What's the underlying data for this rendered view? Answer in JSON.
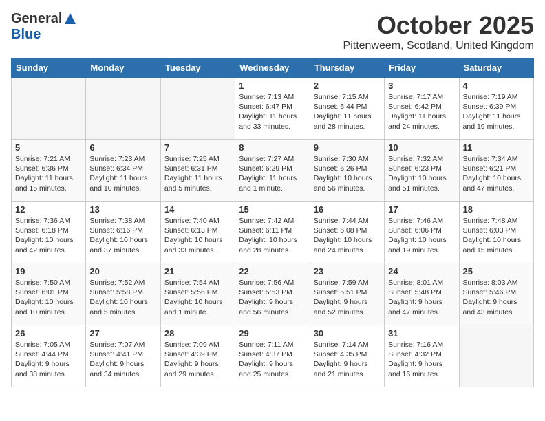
{
  "logo": {
    "general": "General",
    "blue": "Blue"
  },
  "title": "October 2025",
  "location": "Pittenweem, Scotland, United Kingdom",
  "weekdays": [
    "Sunday",
    "Monday",
    "Tuesday",
    "Wednesday",
    "Thursday",
    "Friday",
    "Saturday"
  ],
  "weeks": [
    [
      {
        "day": "",
        "info": ""
      },
      {
        "day": "",
        "info": ""
      },
      {
        "day": "",
        "info": ""
      },
      {
        "day": "1",
        "info": "Sunrise: 7:13 AM\nSunset: 6:47 PM\nDaylight: 11 hours\nand 33 minutes."
      },
      {
        "day": "2",
        "info": "Sunrise: 7:15 AM\nSunset: 6:44 PM\nDaylight: 11 hours\nand 28 minutes."
      },
      {
        "day": "3",
        "info": "Sunrise: 7:17 AM\nSunset: 6:42 PM\nDaylight: 11 hours\nand 24 minutes."
      },
      {
        "day": "4",
        "info": "Sunrise: 7:19 AM\nSunset: 6:39 PM\nDaylight: 11 hours\nand 19 minutes."
      }
    ],
    [
      {
        "day": "5",
        "info": "Sunrise: 7:21 AM\nSunset: 6:36 PM\nDaylight: 11 hours\nand 15 minutes."
      },
      {
        "day": "6",
        "info": "Sunrise: 7:23 AM\nSunset: 6:34 PM\nDaylight: 11 hours\nand 10 minutes."
      },
      {
        "day": "7",
        "info": "Sunrise: 7:25 AM\nSunset: 6:31 PM\nDaylight: 11 hours\nand 5 minutes."
      },
      {
        "day": "8",
        "info": "Sunrise: 7:27 AM\nSunset: 6:29 PM\nDaylight: 11 hours\nand 1 minute."
      },
      {
        "day": "9",
        "info": "Sunrise: 7:30 AM\nSunset: 6:26 PM\nDaylight: 10 hours\nand 56 minutes."
      },
      {
        "day": "10",
        "info": "Sunrise: 7:32 AM\nSunset: 6:23 PM\nDaylight: 10 hours\nand 51 minutes."
      },
      {
        "day": "11",
        "info": "Sunrise: 7:34 AM\nSunset: 6:21 PM\nDaylight: 10 hours\nand 47 minutes."
      }
    ],
    [
      {
        "day": "12",
        "info": "Sunrise: 7:36 AM\nSunset: 6:18 PM\nDaylight: 10 hours\nand 42 minutes."
      },
      {
        "day": "13",
        "info": "Sunrise: 7:38 AM\nSunset: 6:16 PM\nDaylight: 10 hours\nand 37 minutes."
      },
      {
        "day": "14",
        "info": "Sunrise: 7:40 AM\nSunset: 6:13 PM\nDaylight: 10 hours\nand 33 minutes."
      },
      {
        "day": "15",
        "info": "Sunrise: 7:42 AM\nSunset: 6:11 PM\nDaylight: 10 hours\nand 28 minutes."
      },
      {
        "day": "16",
        "info": "Sunrise: 7:44 AM\nSunset: 6:08 PM\nDaylight: 10 hours\nand 24 minutes."
      },
      {
        "day": "17",
        "info": "Sunrise: 7:46 AM\nSunset: 6:06 PM\nDaylight: 10 hours\nand 19 minutes."
      },
      {
        "day": "18",
        "info": "Sunrise: 7:48 AM\nSunset: 6:03 PM\nDaylight: 10 hours\nand 15 minutes."
      }
    ],
    [
      {
        "day": "19",
        "info": "Sunrise: 7:50 AM\nSunset: 6:01 PM\nDaylight: 10 hours\nand 10 minutes."
      },
      {
        "day": "20",
        "info": "Sunrise: 7:52 AM\nSunset: 5:58 PM\nDaylight: 10 hours\nand 5 minutes."
      },
      {
        "day": "21",
        "info": "Sunrise: 7:54 AM\nSunset: 5:56 PM\nDaylight: 10 hours\nand 1 minute."
      },
      {
        "day": "22",
        "info": "Sunrise: 7:56 AM\nSunset: 5:53 PM\nDaylight: 9 hours\nand 56 minutes."
      },
      {
        "day": "23",
        "info": "Sunrise: 7:59 AM\nSunset: 5:51 PM\nDaylight: 9 hours\nand 52 minutes."
      },
      {
        "day": "24",
        "info": "Sunrise: 8:01 AM\nSunset: 5:48 PM\nDaylight: 9 hours\nand 47 minutes."
      },
      {
        "day": "25",
        "info": "Sunrise: 8:03 AM\nSunset: 5:46 PM\nDaylight: 9 hours\nand 43 minutes."
      }
    ],
    [
      {
        "day": "26",
        "info": "Sunrise: 7:05 AM\nSunset: 4:44 PM\nDaylight: 9 hours\nand 38 minutes."
      },
      {
        "day": "27",
        "info": "Sunrise: 7:07 AM\nSunset: 4:41 PM\nDaylight: 9 hours\nand 34 minutes."
      },
      {
        "day": "28",
        "info": "Sunrise: 7:09 AM\nSunset: 4:39 PM\nDaylight: 9 hours\nand 29 minutes."
      },
      {
        "day": "29",
        "info": "Sunrise: 7:11 AM\nSunset: 4:37 PM\nDaylight: 9 hours\nand 25 minutes."
      },
      {
        "day": "30",
        "info": "Sunrise: 7:14 AM\nSunset: 4:35 PM\nDaylight: 9 hours\nand 21 minutes."
      },
      {
        "day": "31",
        "info": "Sunrise: 7:16 AM\nSunset: 4:32 PM\nDaylight: 9 hours\nand 16 minutes."
      },
      {
        "day": "",
        "info": ""
      }
    ]
  ]
}
